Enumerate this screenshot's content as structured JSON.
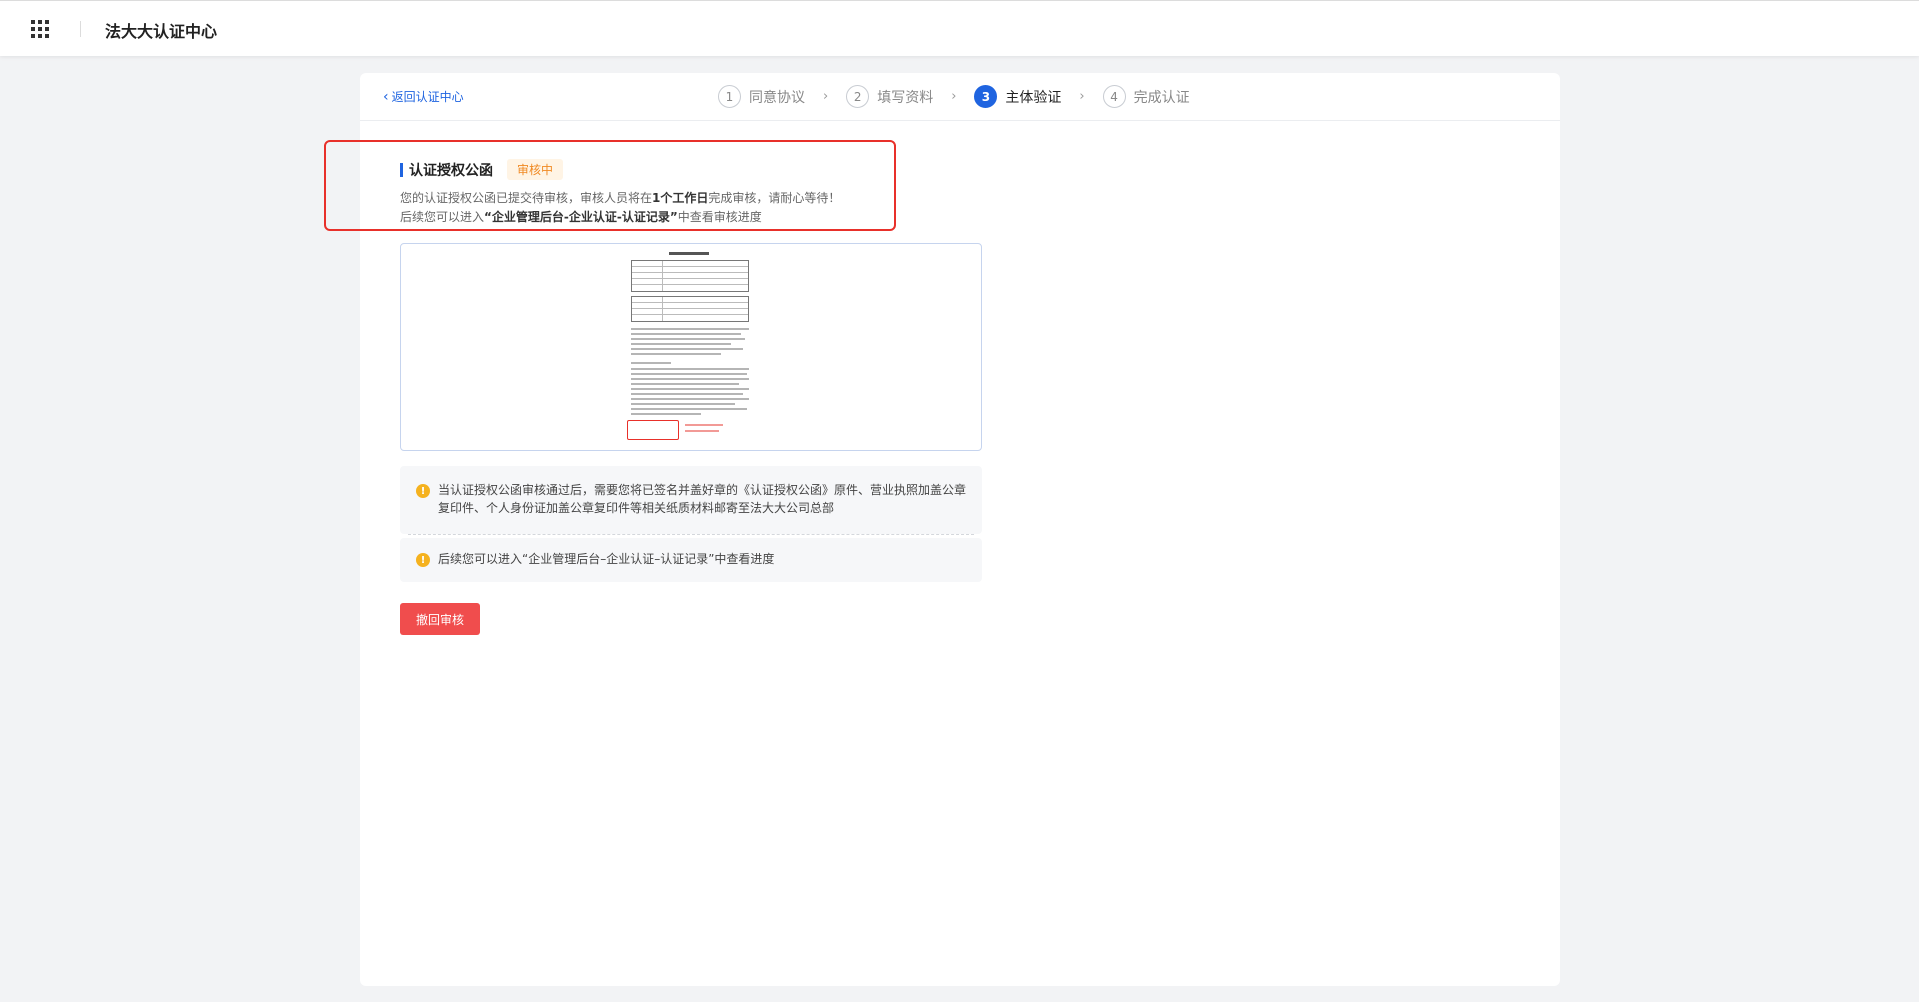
{
  "header": {
    "app_title": "法大大认证中心",
    "apps_icon": "apps-grid-icon"
  },
  "nav": {
    "back_label": "返回认证中心"
  },
  "steps": [
    {
      "num": "1",
      "label": "同意协议",
      "active": false
    },
    {
      "num": "2",
      "label": "填写资料",
      "active": false
    },
    {
      "num": "3",
      "label": "主体验证",
      "active": true
    },
    {
      "num": "4",
      "label": "完成认证",
      "active": false
    }
  ],
  "section": {
    "title": "认证授权公函",
    "status": "审核中",
    "desc_line1_pre": "您的认证授权公函已提交待审核，审核人员将在",
    "desc_line1_bold": "1个工作日",
    "desc_line1_post": "完成审核，请耐心等待！",
    "desc_line2_pre": "后续您可以进入",
    "desc_line2_bold": "“企业管理后台-企业认证-认证记录”",
    "desc_line2_post": "中查看审核进度"
  },
  "notices": [
    {
      "text": "当认证授权公函审核通过后，需要您将已签名并盖好章的《认证授权公函》原件、营业执照加盖公章复印件、个人身份证加盖公章复印件等相关纸质材料邮寄至法大大公司总部"
    },
    {
      "text": "后续您可以进入“企业管理后台–企业认证–认证记录”中查看进度"
    }
  ],
  "actions": {
    "withdraw_label": "撤回审核"
  },
  "colors": {
    "primary": "#1f64e0",
    "danger": "#f04d4d",
    "warning": "#f5b21f",
    "status_badge_text": "#f08a24"
  }
}
